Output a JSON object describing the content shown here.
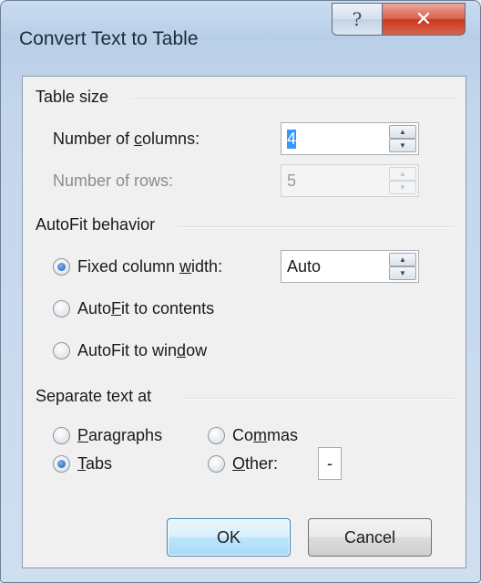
{
  "window": {
    "title": "Convert Text to Table",
    "help_glyph": "?",
    "close_glyph": "✕"
  },
  "table_size": {
    "heading": "Table size",
    "columns": {
      "label_pre": "Number of ",
      "label_mnemonic": "c",
      "label_post": "olumns:",
      "value": "4"
    },
    "rows": {
      "label": "Number of rows:",
      "value": "5"
    }
  },
  "autofit": {
    "heading": "AutoFit behavior",
    "fixed": {
      "label_pre": "Fixed column ",
      "label_mnemonic": "w",
      "label_post": "idth:",
      "value": "Auto",
      "selected": true
    },
    "contents": {
      "label_pre": "Auto",
      "label_mnemonic": "F",
      "label_post": "it to contents",
      "selected": false
    },
    "window": {
      "label_pre": "AutoFit to win",
      "label_mnemonic": "d",
      "label_post": "ow",
      "selected": false
    }
  },
  "separate": {
    "heading": "Separate text at",
    "paragraphs": {
      "label_pre": "",
      "label_mnemonic": "P",
      "label_post": "aragraphs",
      "selected": false
    },
    "commas": {
      "label_pre": "Co",
      "label_mnemonic": "m",
      "label_post": "mas",
      "selected": false
    },
    "tabs": {
      "label_pre": "",
      "label_mnemonic": "T",
      "label_post": "abs",
      "selected": true
    },
    "other": {
      "label_pre": "",
      "label_mnemonic": "O",
      "label_post": "ther:",
      "selected": false,
      "value": "-"
    }
  },
  "buttons": {
    "ok": "OK",
    "cancel": "Cancel"
  },
  "icons": {
    "spin_up": "▲",
    "spin_down": "▼"
  }
}
